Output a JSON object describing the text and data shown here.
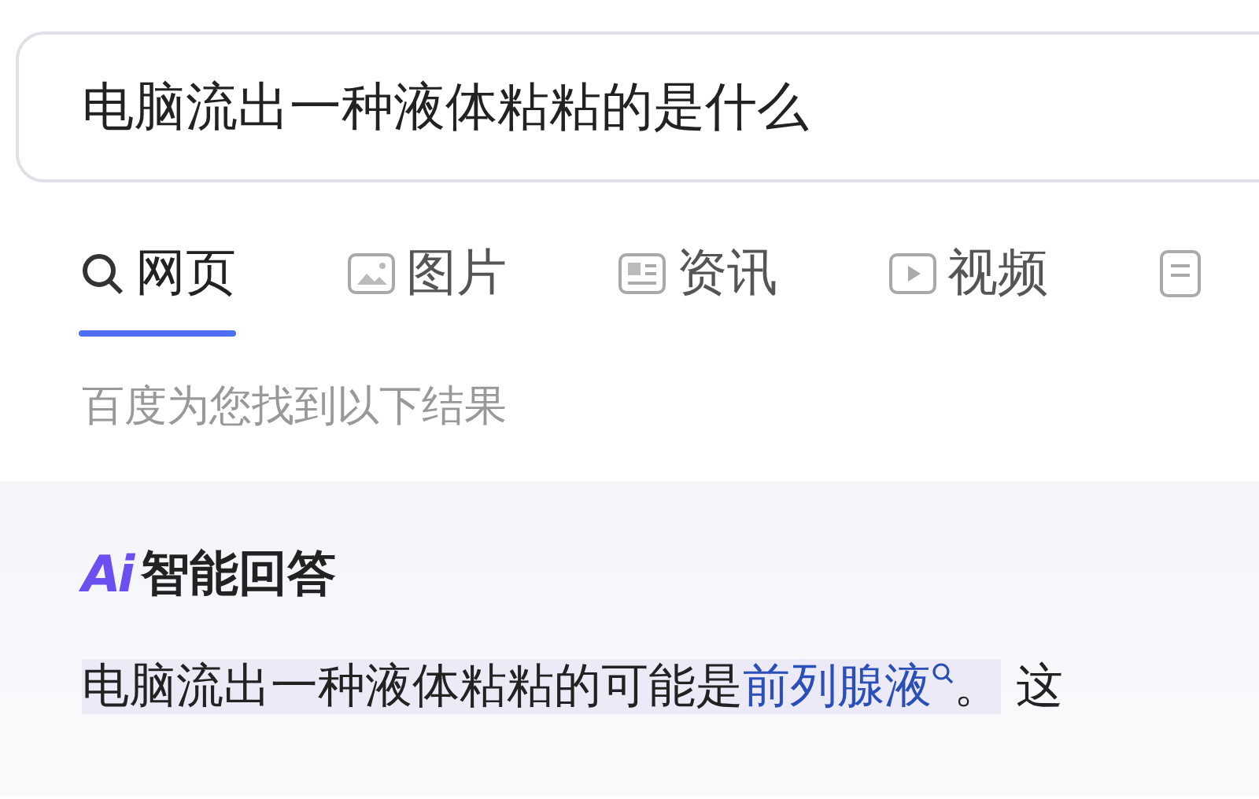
{
  "search": {
    "value": "电脑流出一种液体粘粘的是什么"
  },
  "tabs": [
    {
      "kind": "search",
      "label": "网页",
      "selected": true
    },
    {
      "kind": "image",
      "label": "图片",
      "selected": false
    },
    {
      "kind": "news",
      "label": "资讯",
      "selected": false
    },
    {
      "kind": "video",
      "label": "视频",
      "selected": false
    },
    {
      "kind": "doc",
      "selected": false
    }
  ],
  "result_count": "百度为您找到以下结果",
  "ai_answer": {
    "logo": "Ai",
    "title": "智能回答",
    "text": "电脑流出一种液体粘粘的可能是",
    "link": "前列腺液",
    "after": "。",
    "next": "这"
  }
}
